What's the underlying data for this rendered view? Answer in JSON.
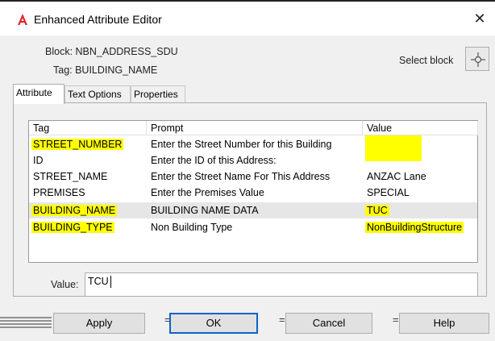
{
  "window": {
    "title": "Enhanced Attribute Editor",
    "close_glyph": "✕"
  },
  "header": {
    "block_text": "Block: NBN_ADDRESS_SDU",
    "tag_text": "Tag: BUILDING_NAME",
    "select_block_label": "Select block"
  },
  "tabs": [
    {
      "label": "Attribute",
      "active": true
    },
    {
      "label": "Text Options",
      "active": false
    },
    {
      "label": "Properties",
      "active": false
    }
  ],
  "grid": {
    "columns": {
      "tag": "Tag",
      "prompt": "Prompt",
      "value": "Value"
    },
    "rows": [
      {
        "tag": "STREET_NUMBER",
        "prompt": "Enter the Street Number for this Building",
        "value": "",
        "highlight_tag": true,
        "highlight_value": true
      },
      {
        "tag": "ID",
        "prompt": "Enter the ID of this Address:",
        "value": "",
        "highlight_tag": false,
        "highlight_value": false
      },
      {
        "tag": "STREET_NAME",
        "prompt": "Enter the Street Name For This Address",
        "value": "ANZAC Lane",
        "highlight_tag": false,
        "highlight_value": false
      },
      {
        "tag": "PREMISES",
        "prompt": "Enter the Premises Value",
        "value": "SPECIAL",
        "highlight_tag": false,
        "highlight_value": false
      },
      {
        "tag": "BUILDING_NAME",
        "prompt": "BUILDING NAME DATA",
        "value": "TUC",
        "highlight_tag": true,
        "highlight_value": true,
        "selected": true
      },
      {
        "tag": "BUILDING_TYPE",
        "prompt": "Non Building Type",
        "value": "NonBuildingStructure",
        "highlight_tag": true,
        "highlight_value": true
      }
    ]
  },
  "value_field": {
    "label": "Value:",
    "value": "TCU"
  },
  "buttons": {
    "apply": "Apply",
    "ok": "OK",
    "cancel": "Cancel",
    "help": "Help"
  },
  "colors": {
    "highlight": "#ffff00",
    "selected_row": "#e6e6e6",
    "ok_border": "#0a64c8",
    "app_icon": "#d9272e"
  },
  "icons": {
    "app": "autocad-a-icon",
    "select": "crosshair-pick-icon"
  }
}
